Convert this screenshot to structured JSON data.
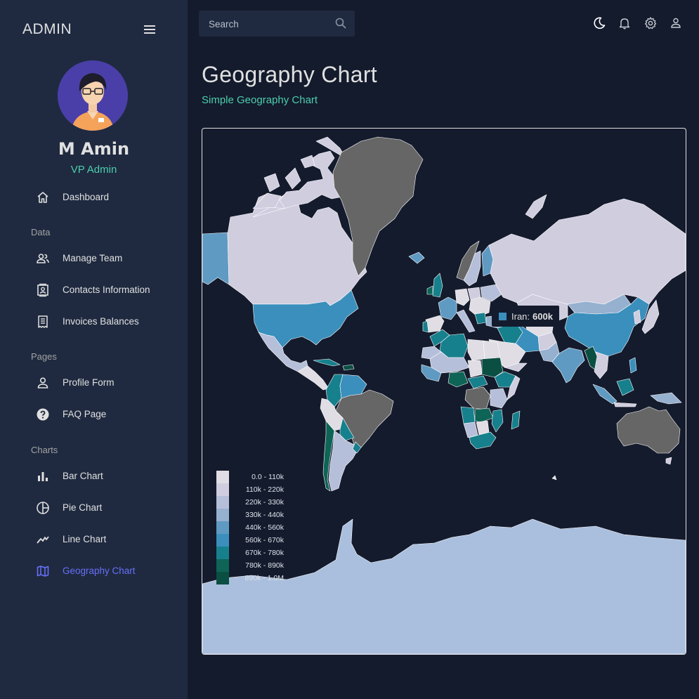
{
  "brand": "ADMIN",
  "user": {
    "name": "M Amin",
    "role": "VP Admin"
  },
  "nav": {
    "dashboard": "Dashboard",
    "sections": {
      "data": "Data",
      "pages": "Pages",
      "charts": "Charts"
    },
    "items": [
      {
        "label": "Manage Team",
        "icon": "team-icon"
      },
      {
        "label": "Contacts Information",
        "icon": "contacts-icon"
      },
      {
        "label": "Invoices Balances",
        "icon": "invoice-icon"
      },
      {
        "label": "Profile Form",
        "icon": "person-icon"
      },
      {
        "label": "FAQ Page",
        "icon": "help-icon"
      },
      {
        "label": "Bar Chart",
        "icon": "bar-chart-icon"
      },
      {
        "label": "Pie Chart",
        "icon": "pie-chart-icon"
      },
      {
        "label": "Line Chart",
        "icon": "line-chart-icon"
      },
      {
        "label": "Geography Chart",
        "icon": "map-icon",
        "active": true
      }
    ]
  },
  "search": {
    "placeholder": "Search"
  },
  "topbar": {
    "icons": [
      "dark-mode-icon",
      "notifications-icon",
      "settings-icon",
      "user-icon"
    ]
  },
  "header": {
    "title": "Geography Chart",
    "subtitle": "Simple Geography Chart"
  },
  "colors": {
    "accent": "#4cceac",
    "active": "#6870fa",
    "background": "#141b2d",
    "panel": "#1f2a40",
    "no_data": "#666666"
  },
  "chart_data": {
    "type": "choropleth",
    "legend": [
      {
        "label": "0.0 - 110k",
        "color": "#e0dde4"
      },
      {
        "label": "110k - 220k",
        "color": "#d0cddf"
      },
      {
        "label": "220k - 330k",
        "color": "#b6bfd9"
      },
      {
        "label": "330k - 440k",
        "color": "#96b0cf"
      },
      {
        "label": "440k - 560k",
        "color": "#5f9ac2"
      },
      {
        "label": "560k - 670k",
        "color": "#3a8fbc"
      },
      {
        "label": "670k - 780k",
        "color": "#17808d"
      },
      {
        "label": "780k - 890k",
        "color": "#0e6456"
      },
      {
        "label": "890k - 1.0M",
        "color": "#0b4f43"
      }
    ],
    "tooltip": {
      "country": "Iran:",
      "value": "600k"
    }
  }
}
